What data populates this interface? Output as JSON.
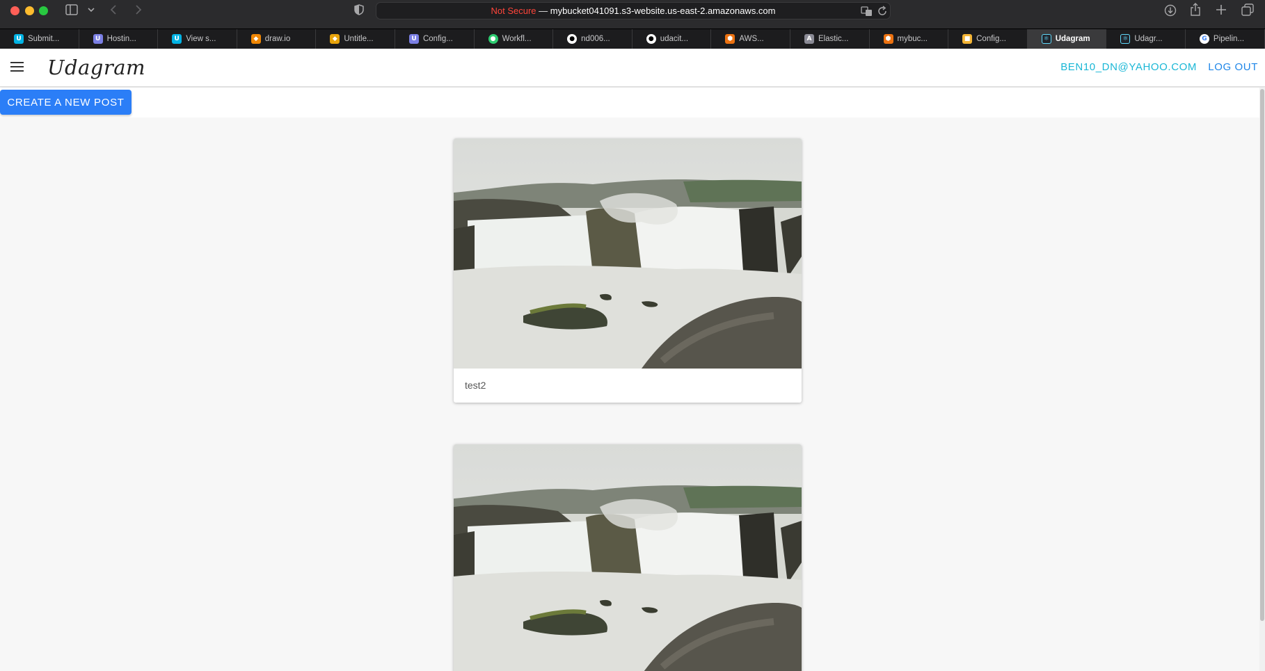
{
  "browser": {
    "url_warning": "Not Secure",
    "url_separator": " — ",
    "url_host": "mybucket041091.s3-website.us-east-2.amazonaws.com",
    "icons": [
      "sidebar-icon",
      "chevron-down-icon",
      "back-icon",
      "forward-icon",
      "shield-icon",
      "translate-icon",
      "reload-icon",
      "download-icon",
      "share-icon",
      "new-tab-icon",
      "tab-overview-icon"
    ],
    "tabs": [
      {
        "label": "Submit...",
        "favicon": "U",
        "active": false
      },
      {
        "label": "Hostin...",
        "favicon": "U",
        "active": false
      },
      {
        "label": "View s...",
        "favicon": "U",
        "active": false
      },
      {
        "label": "draw.io",
        "favicon": "◆",
        "active": false
      },
      {
        "label": "Untitle...",
        "favicon": "◆",
        "active": false
      },
      {
        "label": "Config...",
        "favicon": "U",
        "active": false
      },
      {
        "label": "Workfl...",
        "favicon": "●",
        "active": false
      },
      {
        "label": "nd006...",
        "favicon": "●",
        "active": false
      },
      {
        "label": "udacit...",
        "favicon": "●",
        "active": false
      },
      {
        "label": "AWS...",
        "favicon": "⬢",
        "active": false
      },
      {
        "label": "Elastic...",
        "favicon": "A",
        "active": false
      },
      {
        "label": "mybuc...",
        "favicon": "⬢",
        "active": false
      },
      {
        "label": "Config...",
        "favicon": "■",
        "active": false
      },
      {
        "label": "Udagram",
        "favicon": "⚛",
        "active": true
      },
      {
        "label": "Udagr...",
        "favicon": "⚛",
        "active": false
      },
      {
        "label": "Pipelin...",
        "favicon": "G",
        "active": false
      }
    ]
  },
  "app": {
    "brand": "Udagram",
    "user_email": "BEN10_DN@YAHOO.COM",
    "logout_label": "LOG OUT",
    "create_post_label": "CREATE A NEW POST",
    "accent_color": "#2b7ef7",
    "email_color": "#1ab7d6"
  },
  "feed": {
    "posts": [
      {
        "caption": "test2",
        "image": "waterfall-photo"
      },
      {
        "caption": "",
        "image": "waterfall-photo"
      }
    ]
  }
}
